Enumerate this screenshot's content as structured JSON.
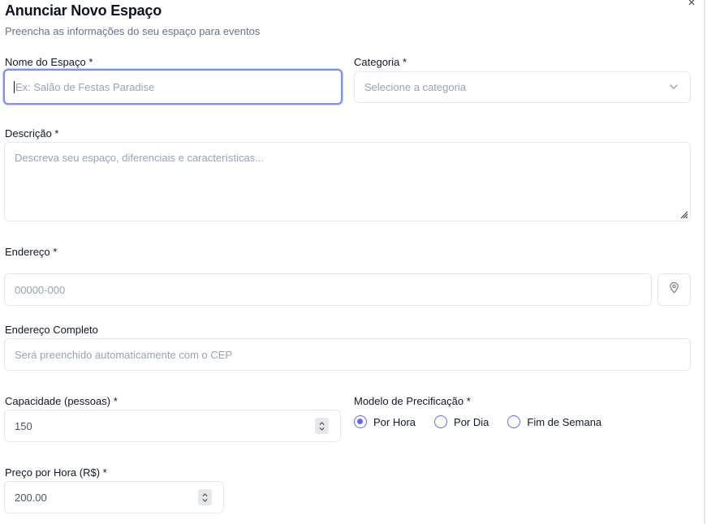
{
  "dialog": {
    "title": "Anunciar Novo Espaço",
    "subtitle": "Preencha as informações do seu espaço para eventos",
    "close_icon": "×"
  },
  "name": {
    "label": "Nome do Espaço *",
    "placeholder": "Ex: Salão de Festas Paradise",
    "value": ""
  },
  "category": {
    "label": "Categoria *",
    "selected": "Selecione a categoria"
  },
  "description": {
    "label": "Descrição *",
    "placeholder": "Descreva seu espaço, diferenciais e características..."
  },
  "address": {
    "label": "Endereço *",
    "cep_placeholder": "00000-000",
    "location_icon": "map-pin-icon"
  },
  "full_address": {
    "label": "Endereço Completo",
    "placeholder": "Será preenchido automaticamente com o CEP"
  },
  "capacity": {
    "label": "Capacidade (pessoas) *",
    "value": "150"
  },
  "pricing_model": {
    "label": "Modelo de Precificação *",
    "options": [
      "Por Hora",
      "Por Dia",
      "Fim de Semana"
    ],
    "selected": "Por Hora"
  },
  "price": {
    "label": "Preço por Hora (R$) *",
    "value": "200.00"
  },
  "colors": {
    "accent": "#6366f1",
    "focus_ring": "#818cf8",
    "border": "#e2e8f0",
    "placeholder": "#94a3b8"
  }
}
